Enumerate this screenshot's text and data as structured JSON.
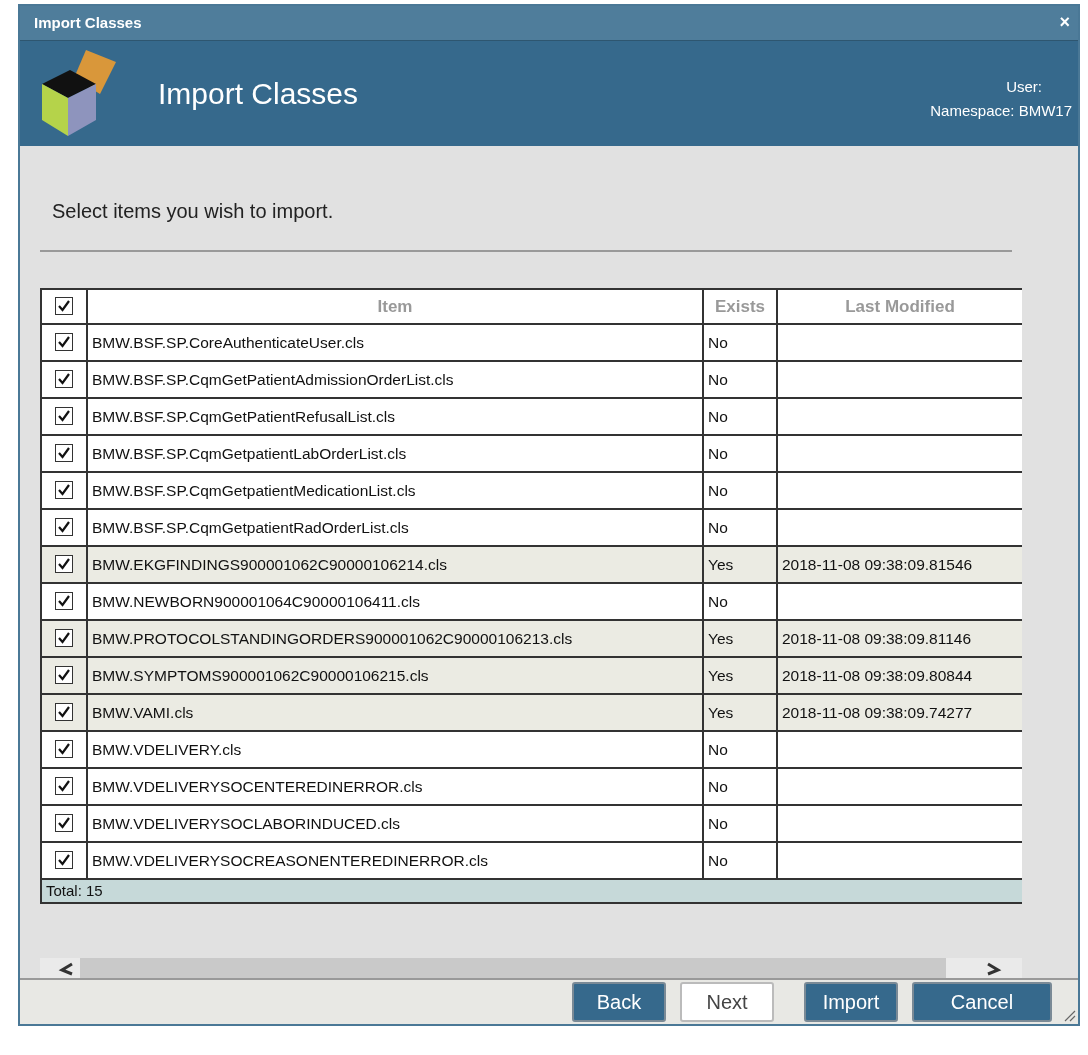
{
  "window": {
    "title": "Import Classes",
    "close": "×"
  },
  "header": {
    "title": "Import Classes",
    "user_label": "User:",
    "namespace": "Namespace: BMW17"
  },
  "instruction": "Select items you wish to import.",
  "table": {
    "select_all": {
      "checked": true
    },
    "columns": [
      "Item",
      "Exists",
      "Last Modified"
    ],
    "rows": [
      {
        "checked": true,
        "highlighted": false,
        "item": "BMW.BSF.SP.CoreAuthenticateUser.cls",
        "exists": "No"
      },
      {
        "checked": true,
        "highlighted": false,
        "item": "BMW.BSF.SP.CqmGetPatientAdmissionOrderList.cls",
        "exists": "No"
      },
      {
        "checked": true,
        "highlighted": false,
        "item": "BMW.BSF.SP.CqmGetPatientRefusalList.cls",
        "exists": "No"
      },
      {
        "checked": true,
        "highlighted": false,
        "item": "BMW.BSF.SP.CqmGetpatientLabOrderList.cls",
        "exists": "No"
      },
      {
        "checked": true,
        "highlighted": false,
        "item": "BMW.BSF.SP.CqmGetpatientMedicationList.cls",
        "exists": "No"
      },
      {
        "checked": true,
        "highlighted": false,
        "item": "BMW.BSF.SP.CqmGetpatientRadOrderList.cls",
        "exists": "No"
      },
      {
        "checked": true,
        "highlighted": true,
        "item": "BMW.EKGFINDINGS900001062C90000106214.cls",
        "exists": "Yes",
        "last_modified": "2018-11-08 09:38:09.81546"
      },
      {
        "checked": true,
        "highlighted": false,
        "item": "BMW.NEWBORN900001064C90000106411.cls",
        "exists": "No"
      },
      {
        "checked": true,
        "highlighted": true,
        "item": "BMW.PROTOCOLSTANDINGORDERS900001062C90000106213.cls",
        "exists": "Yes",
        "last_modified": "2018-11-08 09:38:09.81146"
      },
      {
        "checked": true,
        "highlighted": true,
        "item": "BMW.SYMPTOMS900001062C90000106215.cls",
        "exists": "Yes",
        "last_modified": "2018-11-08 09:38:09.80844"
      },
      {
        "checked": true,
        "highlighted": true,
        "item": "BMW.VAMI.cls",
        "exists": "Yes",
        "last_modified": "2018-11-08 09:38:09.74277"
      },
      {
        "checked": true,
        "highlighted": false,
        "item": "BMW.VDELIVERY.cls",
        "exists": "No"
      },
      {
        "checked": true,
        "highlighted": false,
        "item": "BMW.VDELIVERYSOCENTEREDINERROR.cls",
        "exists": "No"
      },
      {
        "checked": true,
        "highlighted": false,
        "item": "BMW.VDELIVERYSOCLABORINDUCED.cls",
        "exists": "No"
      },
      {
        "checked": true,
        "highlighted": false,
        "item": "BMW.VDELIVERYSOCREASONENTEREDINERROR.cls",
        "exists": "No"
      }
    ],
    "total": "Total: 15"
  },
  "buttons": [
    {
      "label": "Back",
      "disabled": false
    },
    {
      "label": "Next",
      "disabled": true
    },
    {
      "label": "Import",
      "disabled": false
    },
    {
      "label": "Cancel",
      "disabled": false
    }
  ]
}
